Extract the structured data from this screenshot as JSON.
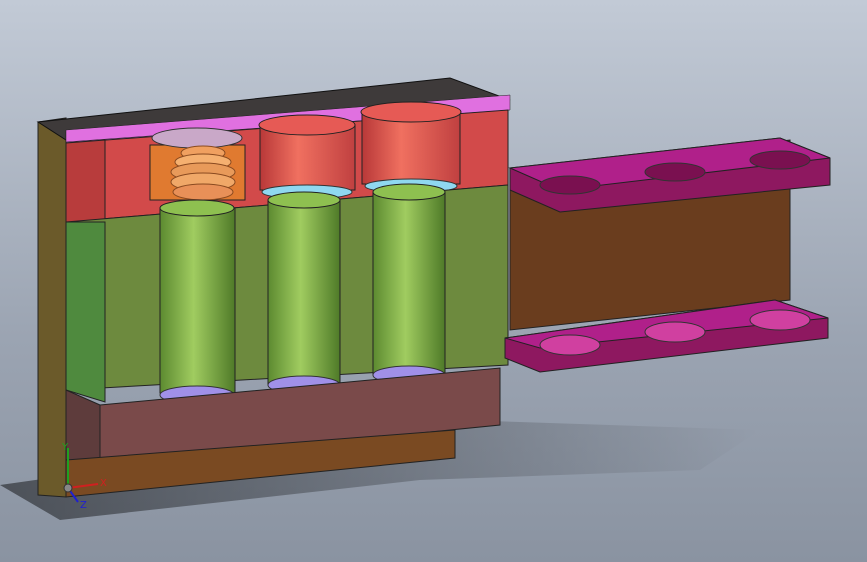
{
  "viewport": {
    "kind": "3d-cad-section-view",
    "background_colors": [
      "#c2cad6",
      "#8a93a1"
    ]
  },
  "model": {
    "part_colors": {
      "frame_side": "#6b5a2a",
      "frame_top": "#3e3a3a",
      "top_plate": "#d45ad8",
      "red_block": "#d24a4a",
      "red_cylinder": "#e65a55",
      "green_block": "#6d8a3e",
      "green_block_side": "#4f8a3e",
      "green_cylinder": "#7fb046",
      "brown_block": "#7a4a4a",
      "bottom_plate": "#7a4a22",
      "orange_part": "#e07a30",
      "purple_bracket": "#8e1860",
      "bracket_interior": "#6a3d1e",
      "cyan_ring": "#8fd8f0",
      "lavender_ring": "#a090e8"
    },
    "cylinder_count": 3,
    "bracket_pocket_count": 3
  },
  "triad": {
    "x_label": "X",
    "y_label": "Y",
    "z_label": "Z",
    "x_color": "#d02020",
    "y_color": "#20a020",
    "z_color": "#2020d0"
  }
}
